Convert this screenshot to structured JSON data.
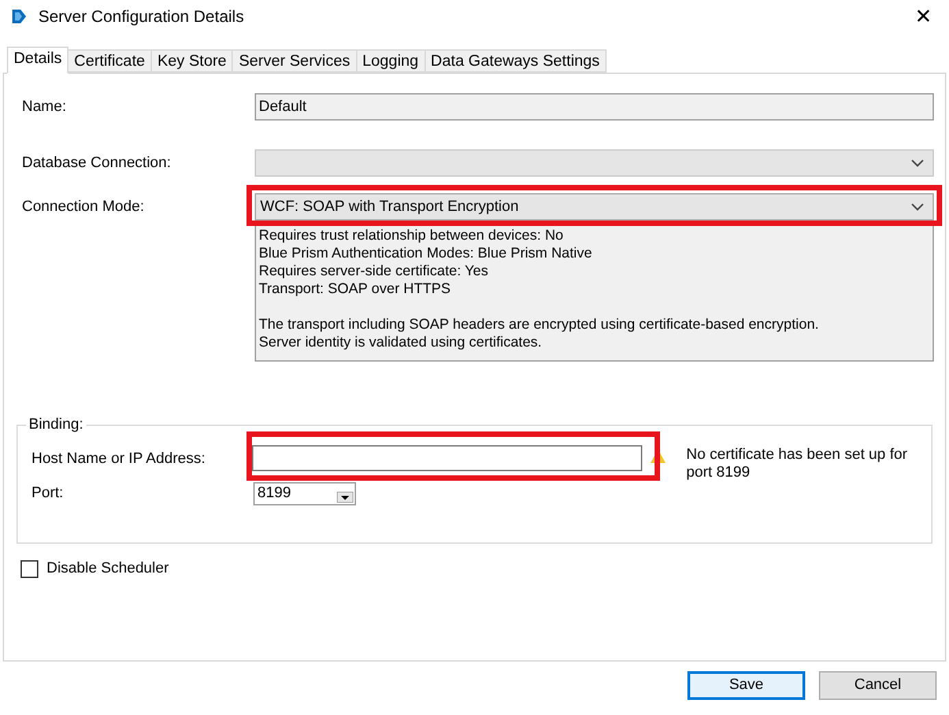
{
  "window": {
    "title": "Server Configuration Details",
    "close": "✕"
  },
  "tabs": [
    {
      "label": "Details",
      "selected": true
    },
    {
      "label": "Certificate",
      "selected": false
    },
    {
      "label": "Key Store",
      "selected": false
    },
    {
      "label": "Server Services",
      "selected": false
    },
    {
      "label": "Logging",
      "selected": false
    },
    {
      "label": "Data Gateways Settings",
      "selected": false
    }
  ],
  "name": {
    "label": "Name:",
    "value": "Default"
  },
  "database_connection": {
    "label": "Database Connection:"
  },
  "connection_mode": {
    "label": "Connection Mode:",
    "value": "WCF: SOAP with Transport Encryption",
    "highlighted": true
  },
  "description": [
    [
      "Requires trust relationship between devices: No",
      "Blue Prism Authentication Modes: Blue Prism Native",
      "Requires server-side certificate: Yes",
      "Transport: SOAP over HTTPS"
    ],
    [
      "The transport including SOAP headers are encrypted using certificate-based encryption.",
      "Server identity is validated using certificates."
    ]
  ],
  "binding": {
    "title": "Binding:",
    "host": {
      "label": "Host Name or IP Address:",
      "highlighted": true
    },
    "warning": "No certificate has been set up for port 8199",
    "port": {
      "label": "Port:",
      "value": "8199"
    }
  },
  "disable_scheduler": {
    "label": "Disable Scheduler",
    "checked": false
  },
  "buttons": [
    {
      "label": "Save",
      "default": true
    },
    {
      "label": "Cancel",
      "default": false
    }
  ]
}
